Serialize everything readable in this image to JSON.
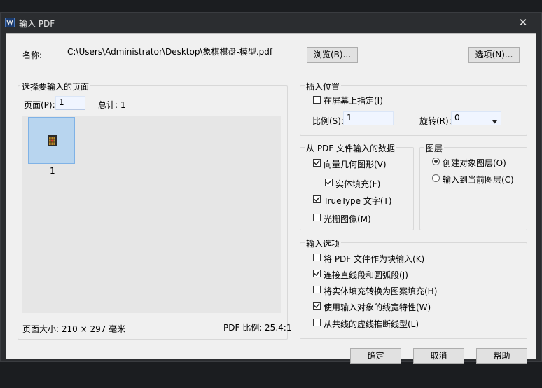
{
  "window": {
    "title": "输入 PDF",
    "close_glyph": "✕",
    "icon": "app-logo-icon"
  },
  "name_row": {
    "label": "名称:",
    "path": "C:\\Users\\Administrator\\Desktop\\象棋棋盘-模型.pdf",
    "browse_label": "浏览(B)...",
    "options_label": "选项(N)..."
  },
  "page_select": {
    "title": "选择要输入的页面",
    "page_label": "页面(P):",
    "page_value": "1",
    "total_label": "总计: 1",
    "thumb_caption": "1",
    "page_size": "页面大小: 210 × 297 毫米",
    "pdf_scale": "PDF 比例: 25.4:1"
  },
  "insert_point": {
    "title": "插入位置",
    "on_screen_label": "在屏幕上指定(I)",
    "on_screen_checked": false,
    "scale_label": "比例(S):",
    "scale_value": "1",
    "rotation_label": "旋转(R):",
    "rotation_value": "0"
  },
  "pdf_data": {
    "title": "从 PDF 文件输入的数据",
    "items": [
      {
        "label": "向量几何图形(V)",
        "checked": true
      },
      {
        "label": "实体填充(F)",
        "checked": true
      },
      {
        "label": "TrueType 文字(T)",
        "checked": true
      },
      {
        "label": "光栅图像(M)",
        "checked": false
      }
    ]
  },
  "layers": {
    "title": "图层",
    "options": [
      {
        "label": "创建对象图层(O)",
        "selected": true
      },
      {
        "label": "输入到当前图层(C)",
        "selected": false
      }
    ]
  },
  "import_options": {
    "title": "输入选项",
    "items": [
      {
        "label": "将 PDF 文件作为块输入(K)",
        "checked": false
      },
      {
        "label": "连接直线段和圆弧段(J)",
        "checked": true
      },
      {
        "label": "将实体填充转换为图案填充(H)",
        "checked": false
      },
      {
        "label": "使用输入对象的线宽特性(W)",
        "checked": true
      },
      {
        "label": "从共线的虚线推断线型(L)",
        "checked": false
      }
    ]
  },
  "footer": {
    "ok_label": "确定",
    "cancel_label": "取消",
    "help_label": "帮助"
  }
}
